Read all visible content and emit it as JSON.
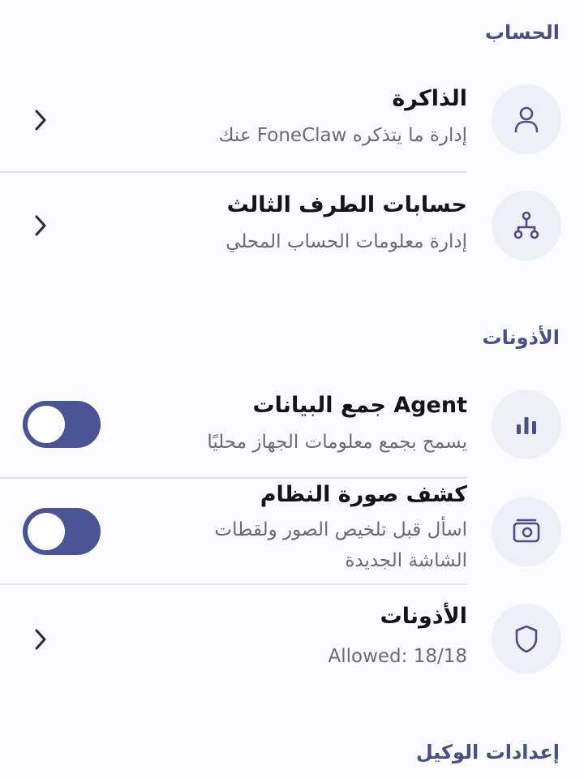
{
  "sections": {
    "account": {
      "title": "الحساب"
    },
    "permissions": {
      "title": "الأذونات"
    },
    "agent_settings": {
      "title": "إعدادات الوكيل"
    }
  },
  "account_items": [
    {
      "title": "الذاكرة",
      "subtitle": "إدارة ما يتذكره FoneClaw عنك",
      "icon": "person-icon"
    },
    {
      "title": "حسابات الطرف الثالث",
      "subtitle": "إدارة معلومات الحساب المحلي",
      "icon": "hierarchy-icon"
    }
  ],
  "permission_items": [
    {
      "title": "Agent جمع البيانات",
      "subtitle": "يسمح بجمع معلومات الجهاز محليًا",
      "icon": "bar-chart-icon",
      "toggle_on": false
    },
    {
      "title": "كشف صورة النظام",
      "subtitle": "اسأل قبل تلخيص الصور ولقطات الشاشة الجديدة",
      "icon": "photo-icon",
      "toggle_on": false
    },
    {
      "title": "الأذونات",
      "subtitle": "Allowed: 18/18",
      "icon": "shield-icon"
    }
  ],
  "colors": {
    "accent": "#4a4f86",
    "toggle_track": "#4c5394",
    "icon_bg": "#eef0f8",
    "background": "#fbfbfd"
  }
}
